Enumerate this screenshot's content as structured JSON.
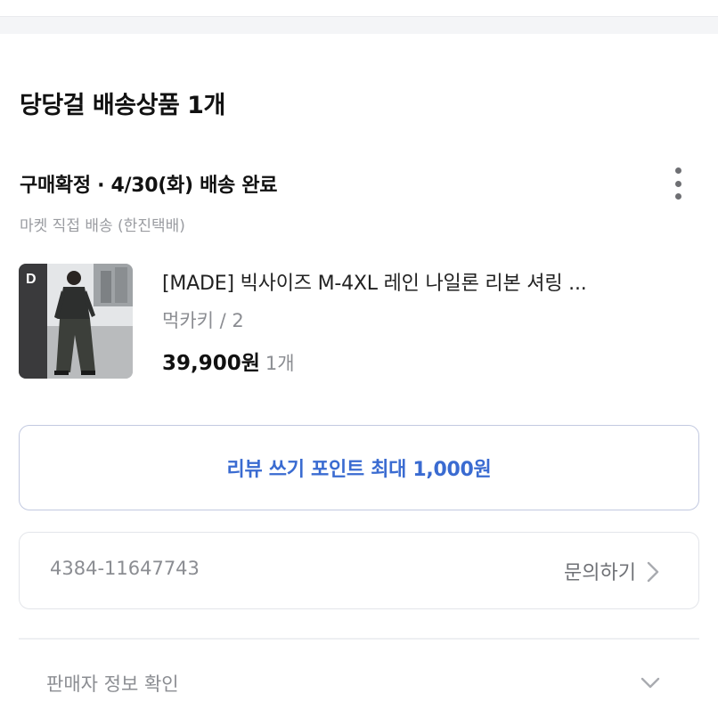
{
  "shipment": {
    "title": "당당걸 배송상품 1개",
    "status": "구매확정 · 4/30(화) 배송 완료",
    "carrier": "마켓 직접 배송 (한진택배)"
  },
  "product": {
    "thumb_badge": "D",
    "name": "[MADE] 빅사이즈 M-4XL 레인 나일론 리본 셔링 ...",
    "option": "먹카키 / 2",
    "price": "39,900원",
    "quantity": "1개"
  },
  "review": {
    "label": "리뷰 쓰기 포인트 최대 1,000원"
  },
  "inquiry": {
    "order_number": "4384-11647743",
    "label": "문의하기"
  },
  "seller": {
    "label": "판매자 정보 확인"
  },
  "colors": {
    "accent": "#3a6bd1",
    "muted_text": "#8b8d92",
    "review_border": "#c2c9e0"
  },
  "icons": {
    "more": "more-vertical-icon",
    "inquiry_arrow": "chevron-right-icon",
    "seller_toggle": "chevron-down-icon"
  }
}
